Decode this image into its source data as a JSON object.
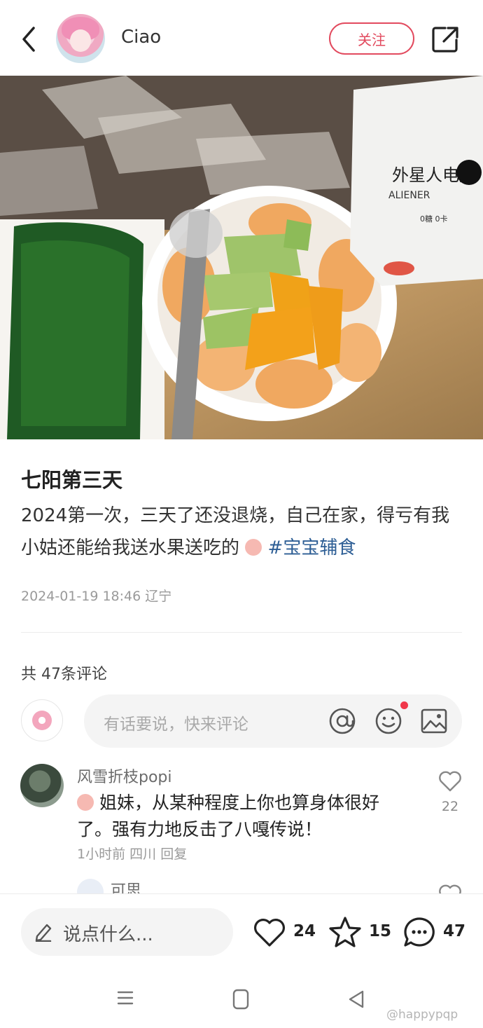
{
  "header": {
    "username": "Ciao",
    "follow_label": "关注",
    "icons": {
      "back": "back-arrow-icon",
      "share": "share-icon"
    }
  },
  "post": {
    "title": "七阳第三天",
    "body_text": "2024第一次，三天了还没退烧，自己在家，得亏有我小姑还能给我送水果送吃的",
    "hashtag": "#宝宝辅食",
    "date": "2024-01-19 18:46",
    "location": "辽宁",
    "photo_drink_text": "外星人电解",
    "photo_drink_brand": "ALIENER",
    "photo_drink_tag": "0糖 0卡"
  },
  "comments": {
    "count_label": "共 47条评论",
    "input_placeholder": "有话要说，快来评论",
    "items": [
      {
        "author": "风雪折枝popi",
        "text": "姐妹，从某种程度上你也算身体很好了。强有力地反击了八嘎传说！",
        "time": "1小时前",
        "location": "四川",
        "reply_label": "回复",
        "likes": "22"
      }
    ],
    "reply_preview": {
      "author": "可思"
    }
  },
  "bottom_bar": {
    "say_placeholder": "说点什么...",
    "likes": "24",
    "stars": "15",
    "comments": "47"
  },
  "watermark": "@happypqp",
  "colors": {
    "accent": "#e24a5e",
    "hashtag": "#2d5e95",
    "muted": "#9a9a9a",
    "notify_dot": "#f0374a"
  }
}
